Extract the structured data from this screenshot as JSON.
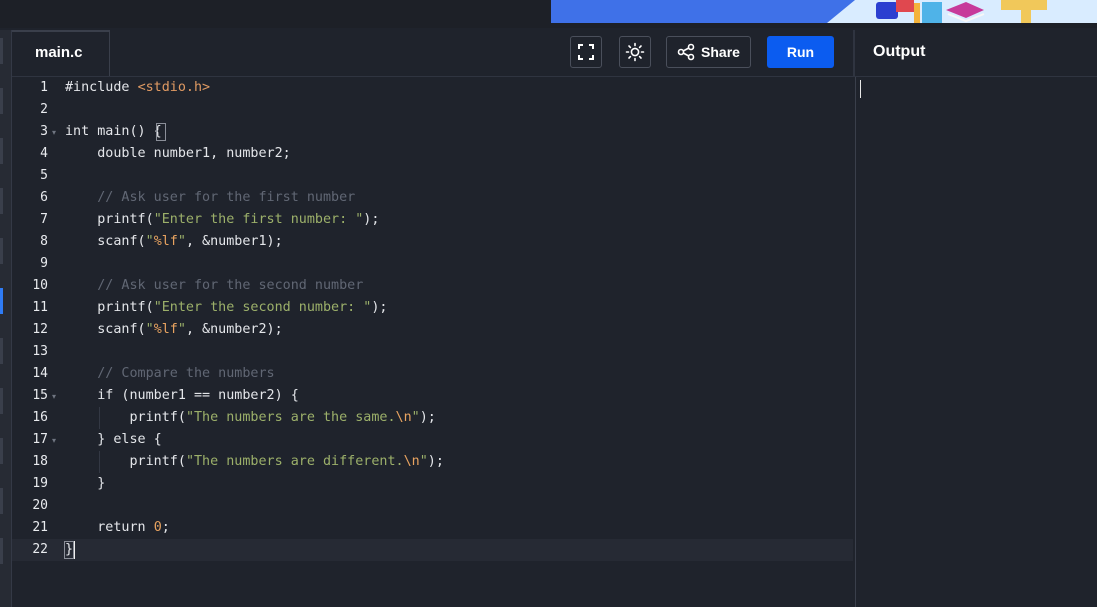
{
  "file_tab": {
    "label": "main.c"
  },
  "toolbar": {
    "fullscreen_icon": "fullscreen-icon",
    "theme_icon": "sun-icon",
    "share_label": "Share",
    "share_icon": "share-icon",
    "run_label": "Run"
  },
  "output": {
    "title": "Output",
    "content": ""
  },
  "colors": {
    "accent": "#0b5cf0",
    "background": "#1f232c",
    "comment": "#616774",
    "string": "#9cb06a",
    "escape": "#e8a360",
    "include_path": "#e09a63"
  },
  "editor": {
    "current_line": 22,
    "lines": [
      "#include <stdio.h>",
      "",
      "int main() {",
      "    double number1, number2;",
      "",
      "    // Ask user for the first number",
      "    printf(\"Enter the first number: \");",
      "    scanf(\"%lf\", &number1);",
      "",
      "    // Ask user for the second number",
      "    printf(\"Enter the second number: \");",
      "    scanf(\"%lf\", &number2);",
      "",
      "    // Compare the numbers",
      "    if (number1 == number2) {",
      "        printf(\"The numbers are the same.\\n\");",
      "    } else {",
      "        printf(\"The numbers are different.\\n\");",
      "    }",
      "",
      "    return 0;",
      "}"
    ],
    "fold_lines": [
      3,
      15,
      17
    ]
  }
}
